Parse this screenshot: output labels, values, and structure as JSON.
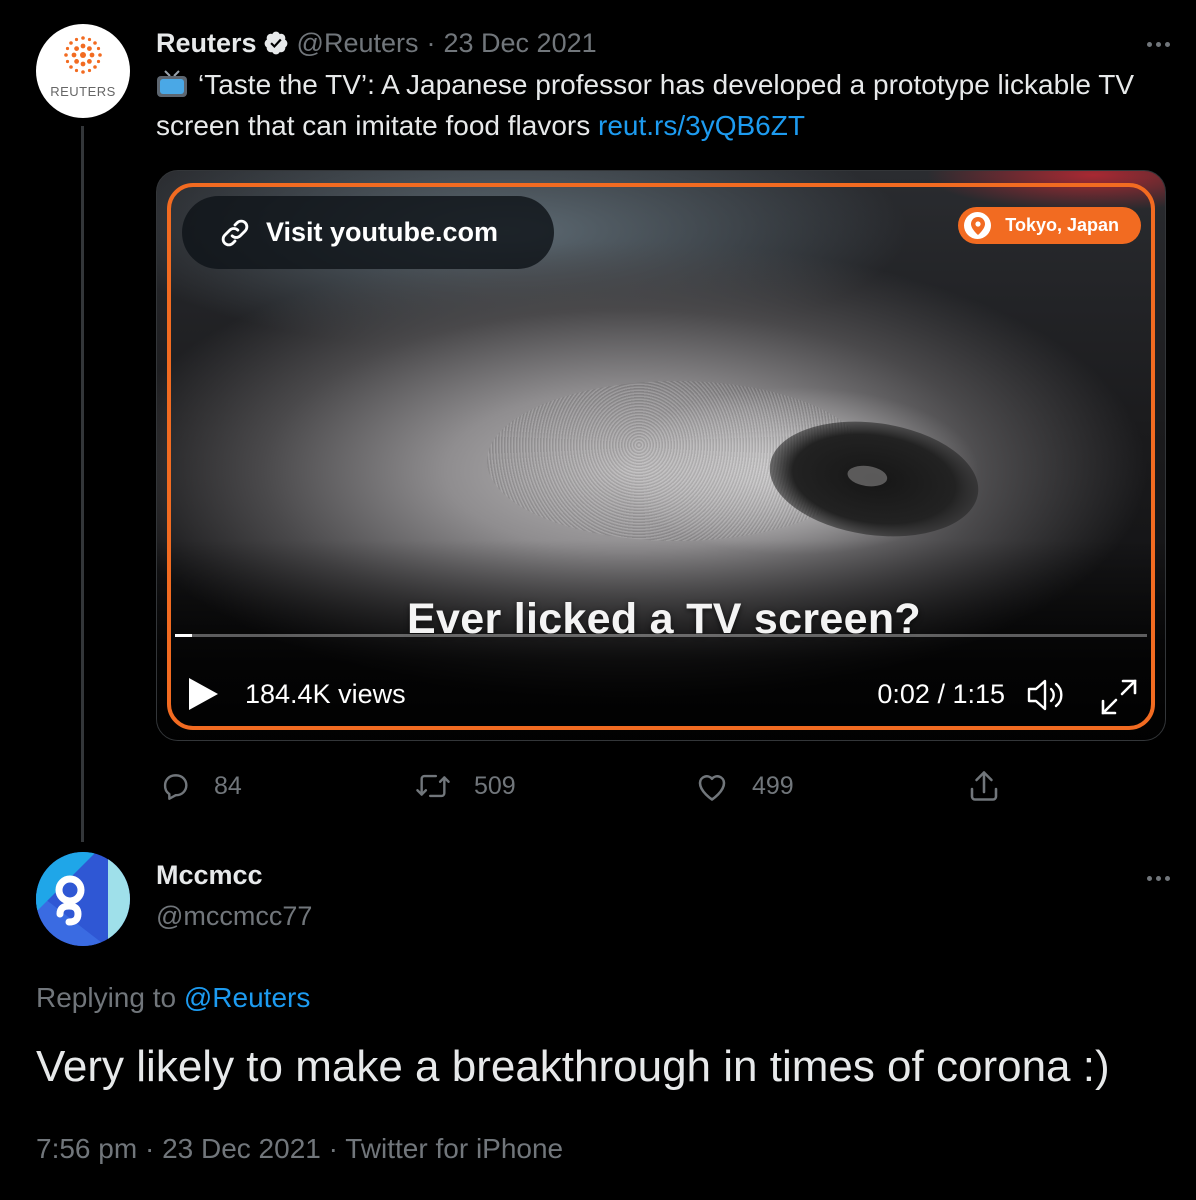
{
  "parent_tweet": {
    "display_name": "Reuters",
    "avatar_wordmark": "REUTERS",
    "handle": "@Reuters",
    "separator": "·",
    "date": "23 Dec 2021",
    "text": "‘Taste the TV’: A Japanese professor has developed a prototype lickable TV screen that can imitate food flavors",
    "link": "reut.rs/3yQB6ZT",
    "media": {
      "visit_label": "Visit youtube.com",
      "location": "Tokyo, Japan",
      "caption": "Ever licked a TV screen?",
      "views": "184.4K views",
      "time": "0:02 / 1:15",
      "progress": 0.018
    },
    "actions": {
      "replies": "84",
      "retweets": "509",
      "likes": "499"
    }
  },
  "reply_tweet": {
    "display_name": "Mccmcc",
    "handle": "@mccmcc77",
    "replying_prefix": "Replying to",
    "replying_to": "@Reuters",
    "text": "Very likely to make a breakthrough in times of corona :)",
    "time": "7:56 pm",
    "date": "23 Dec 2021",
    "source": "Twitter for iPhone"
  },
  "colors": {
    "background": "#000000",
    "accent_blue": "#1d9bf0",
    "muted_text": "#71767b",
    "reuters_orange": "#f26b21"
  }
}
